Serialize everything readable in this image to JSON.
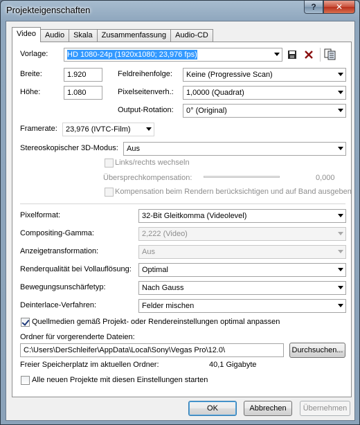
{
  "window": {
    "title": "Projekteigenschaften"
  },
  "tabs": [
    "Video",
    "Audio",
    "Skala",
    "Zusammenfassung",
    "Audio-CD"
  ],
  "video": {
    "template_label": "Vorlage:",
    "template_value": "HD 1080-24p (1920x1080; 23,976 fps)",
    "width_label": "Breite:",
    "width_value": "1.920",
    "height_label": "Höhe:",
    "height_value": "1.080",
    "field_order_label": "Feldreihenfolge:",
    "field_order_value": "Keine (Progressive Scan)",
    "pixel_aspect_label": "Pixelseitenverh.:",
    "pixel_aspect_value": "1,0000 (Quadrat)",
    "output_rotation_label": "Output-Rotation:",
    "output_rotation_value": "0° (Original)",
    "framerate_label": "Framerate:",
    "framerate_value": "23,976 (IVTC-Film)",
    "stereo_label": "Stereoskopischer 3D-Modus:",
    "stereo_value": "Aus",
    "swap_lr_label": "Links/rechts wechseln",
    "crosstalk_label": "Übersprechkompensation:",
    "crosstalk_value": "0,000",
    "compensation_label": "Kompensation beim Rendern berücksichtigen und auf Band ausgeben",
    "pixel_format_label": "Pixelformat:",
    "pixel_format_value": "32-Bit Gleitkomma (Videolevel)",
    "gamma_label": "Compositing-Gamma:",
    "gamma_value": "2,222 (Video)",
    "view_transform_label": "Anzeigetransformation:",
    "view_transform_value": "Aus",
    "render_quality_label": "Renderqualität bei Vollauflösung:",
    "render_quality_value": "Optimal",
    "motion_blur_label": "Bewegungsunschärfetyp:",
    "motion_blur_value": "Nach Gauss",
    "deinterlace_label": "Deinterlace-Verfahren:",
    "deinterlace_value": "Felder mischen",
    "adapt_media_label": "Quellmedien gemäß Projekt- oder Rendereinstellungen optimal anpassen",
    "prerender_folder_label": "Ordner für vorgerenderte Dateien:",
    "prerender_folder_value": "C:\\Users\\DerSchleifer\\AppData\\Local\\Sony\\Vegas Pro\\12.0\\",
    "browse_label": "Durchsuchen...",
    "free_space_label": "Freier Speicherplatz im aktuellen Ordner:",
    "free_space_value": "40,1 Gigabyte",
    "start_all_label": "Alle neuen Projekte mit diesen Einstellungen starten"
  },
  "buttons": {
    "ok": "OK",
    "cancel": "Abbrechen",
    "apply": "Übernehmen"
  },
  "checks": {
    "swap_lr": false,
    "compensation": false,
    "adapt_media": true,
    "start_all": false
  }
}
